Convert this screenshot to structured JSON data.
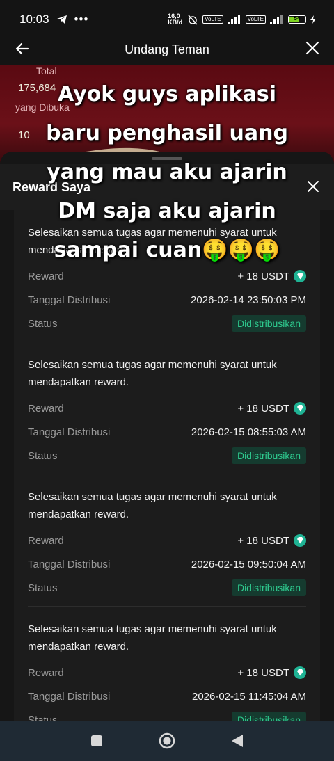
{
  "status_bar": {
    "time": "10:03",
    "net_speed": "16,0 KB/d",
    "battery": "54"
  },
  "header": {
    "title": "Undang Teman"
  },
  "hero": {
    "label_total": "Total",
    "total_value": "175,684",
    "label_dibuka": "yang Dibuka",
    "partial_value": "10"
  },
  "sheet": {
    "title": "Reward Saya",
    "items": [
      {
        "desc": "Selesaikan semua tugas agar memenuhi syarat untuk mendapatkan reward.",
        "reward_label": "Reward",
        "reward_value": "+ 18 USDT",
        "date_label": "Tanggal Distribusi",
        "date_value": "2026-02-14 23:50:03 PM",
        "status_label": "Status",
        "status_value": "Didistribusikan"
      },
      {
        "desc": "Selesaikan semua tugas agar memenuhi syarat untuk mendapatkan reward.",
        "reward_label": "Reward",
        "reward_value": "+ 18 USDT",
        "date_label": "Tanggal Distribusi",
        "date_value": "2026-02-15 08:55:03 AM",
        "status_label": "Status",
        "status_value": "Didistribusikan"
      },
      {
        "desc": "Selesaikan semua tugas agar memenuhi syarat untuk mendapatkan reward.",
        "reward_label": "Reward",
        "reward_value": "+ 18 USDT",
        "date_label": "Tanggal Distribusi",
        "date_value": "2026-02-15 09:50:04 AM",
        "status_label": "Status",
        "status_value": "Didistribusikan"
      },
      {
        "desc": "Selesaikan semua tugas agar memenuhi syarat untuk mendapatkan reward.",
        "reward_label": "Reward",
        "reward_value": "+ 18 USDT",
        "date_label": "Tanggal Distribusi",
        "date_value": "2026-02-15 11:45:04 AM",
        "status_label": "Status",
        "status_value": "Didistribusikan"
      }
    ]
  },
  "overlay_caption": {
    "line1": "Ayok guys aplikasi",
    "line2": "baru penghasil uang",
    "line3": "yang mau aku ajarin",
    "line4": "DM saja aku ajarin",
    "line5": "sampai cuan🤑🤑🤑"
  },
  "colors": {
    "status_green": "#2ec98e",
    "usdt_icon": "#1fb394",
    "hero_red": "#6b1018"
  }
}
